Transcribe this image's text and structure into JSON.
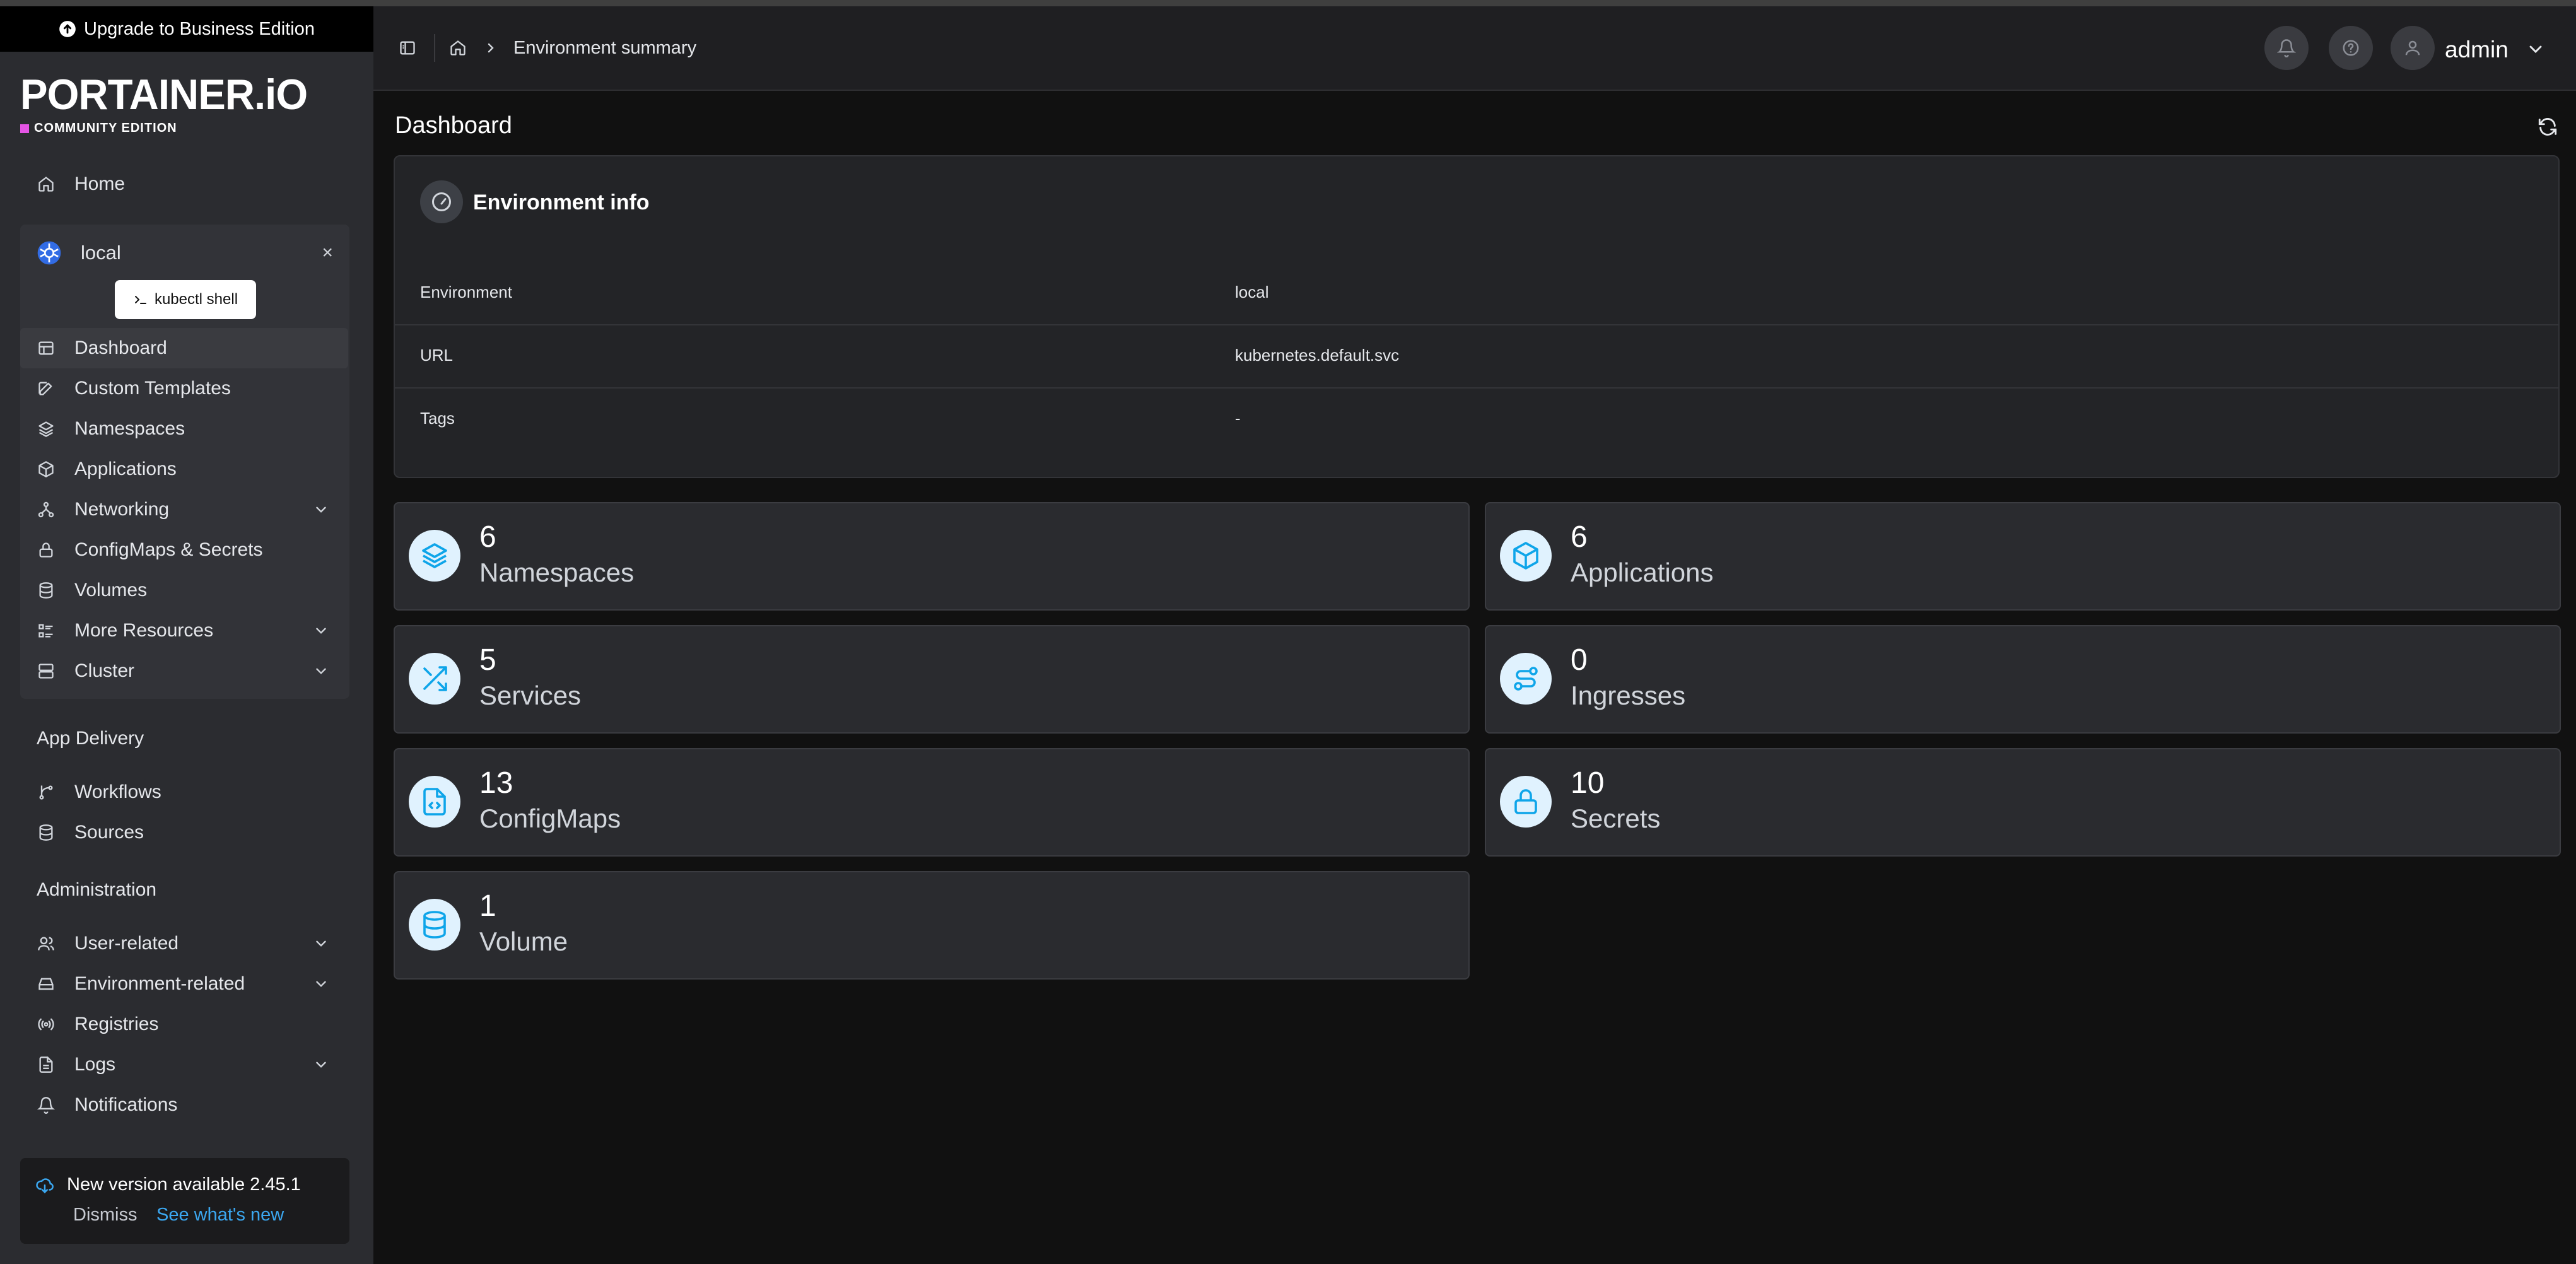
{
  "upgrade_banner": "Upgrade to Business Edition",
  "brand": {
    "logo": "PORTAINER.iO",
    "edition": "COMMUNITY EDITION"
  },
  "sidebar": {
    "home": "Home",
    "environment": {
      "name": "local",
      "close": "×",
      "kubectl_button": "kubectl shell"
    },
    "env_items": [
      {
        "label": "Dashboard",
        "icon": "dashboard-icon"
      },
      {
        "label": "Custom Templates",
        "icon": "edit-icon"
      },
      {
        "label": "Namespaces",
        "icon": "layers-icon"
      },
      {
        "label": "Applications",
        "icon": "box-icon"
      },
      {
        "label": "Networking",
        "icon": "network-icon"
      },
      {
        "label": "ConfigMaps & Secrets",
        "icon": "lock-icon"
      },
      {
        "label": "Volumes",
        "icon": "database-icon"
      },
      {
        "label": "More Resources",
        "icon": "list-icon"
      },
      {
        "label": "Cluster",
        "icon": "server-icon"
      }
    ],
    "app_delivery": {
      "title": "App Delivery",
      "items": [
        "Workflows",
        "Sources"
      ]
    },
    "administration": {
      "title": "Administration",
      "items": [
        "User-related",
        "Environment-related",
        "Registries",
        "Logs",
        "Notifications"
      ]
    },
    "update": {
      "title": "New version available 2.45.1",
      "dismiss": "Dismiss",
      "whats_new": "See what's new"
    }
  },
  "header": {
    "breadcrumb": "Environment summary",
    "user": "admin"
  },
  "main": {
    "title": "Dashboard",
    "env_info": {
      "title": "Environment info",
      "rows": [
        {
          "key": "Environment",
          "value": "local"
        },
        {
          "key": "URL",
          "value": "kubernetes.default.svc"
        },
        {
          "key": "Tags",
          "value": "-"
        }
      ]
    },
    "cards": [
      {
        "count": "6",
        "label": "Namespaces",
        "icon": "layers-icon"
      },
      {
        "count": "6",
        "label": "Applications",
        "icon": "box-icon"
      },
      {
        "count": "5",
        "label": "Services",
        "icon": "shuffle-icon"
      },
      {
        "count": "0",
        "label": "Ingresses",
        "icon": "route-icon"
      },
      {
        "count": "13",
        "label": "ConfigMaps",
        "icon": "file-code-icon"
      },
      {
        "count": "10",
        "label": "Secrets",
        "icon": "lock-icon"
      },
      {
        "count": "1",
        "label": "Volume",
        "icon": "database-icon"
      }
    ]
  },
  "colors": {
    "accent": "#3ba7f0",
    "icon_blue": "#0ea5e9",
    "icon_bg": "#e0f2fe",
    "brand_pink": "#e454e4"
  }
}
